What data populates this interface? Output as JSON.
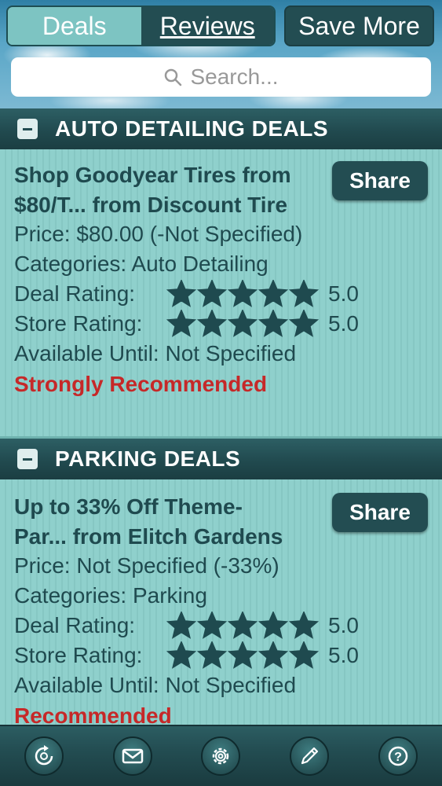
{
  "header": {
    "tabs": [
      {
        "label": "Deals",
        "active": true
      },
      {
        "label": "Reviews",
        "active": false
      }
    ],
    "save_more_label": "Save More",
    "search_placeholder": "Search..."
  },
  "sections": [
    {
      "title": "AUTO DETAILING DEALS",
      "deal": {
        "title_line1": "Shop Goodyear Tires from",
        "title_line2": "$80/T... from Discount Tire",
        "share_label": "Share",
        "price": "Price: $80.00 (-Not Specified)",
        "categories": "Categories: Auto Detailing",
        "deal_rating_label": "Deal Rating:",
        "deal_rating_value": "5.0",
        "deal_rating_stars": 5,
        "store_rating_label": "Store Rating:",
        "store_rating_value": "5.0",
        "store_rating_stars": 5,
        "available": "Available Until: Not Specified",
        "recommendation": "Strongly Recommended"
      }
    },
    {
      "title": "PARKING DEALS",
      "deal": {
        "title_line1": "Up to 33% Off Theme-",
        "title_line2": "Par... from Elitch Gardens",
        "share_label": "Share",
        "price": "Price: Not Specified (-33%)",
        "categories": "Categories: Parking",
        "deal_rating_label": "Deal Rating:",
        "deal_rating_value": "5.0",
        "deal_rating_stars": 5,
        "store_rating_label": "Store Rating:",
        "store_rating_value": "5.0",
        "store_rating_stars": 5,
        "available": "Available Until: Not Specified",
        "recommendation": "Recommended"
      }
    }
  ],
  "tabbar": {
    "icons": [
      "refresh-icon",
      "mail-icon",
      "gear-icon",
      "pencil-icon",
      "help-icon"
    ]
  },
  "colors": {
    "dark_teal": "#234d52",
    "card_bg": "#8fd0cc",
    "text": "#1f4a4f",
    "recommend_red": "#c62828"
  }
}
